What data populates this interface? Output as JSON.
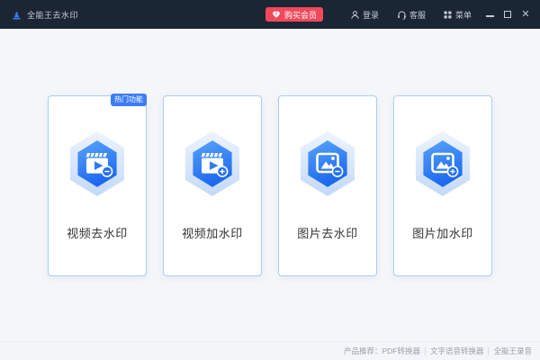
{
  "app": {
    "title": "全能王去水印"
  },
  "titlebar": {
    "buy_button_label": "购买会员",
    "login_label": "登录",
    "support_label": "客服",
    "menu_label": "菜单",
    "icons": {
      "logo": "stamp-icon",
      "buy": "heart-icon",
      "login": "user-icon",
      "support": "headset-icon",
      "menu": "grid-menu-icon",
      "window": [
        "minimize-icon",
        "maximize-icon",
        "close-icon"
      ]
    }
  },
  "cards": [
    {
      "label": "视频去水印",
      "badge": "热门功能",
      "icon": "video-remove-watermark-icon"
    },
    {
      "label": "视频加水印",
      "icon": "video-add-watermark-icon"
    },
    {
      "label": "图片去水印",
      "icon": "image-remove-watermark-icon"
    },
    {
      "label": "图片加水印",
      "icon": "image-add-watermark-icon"
    }
  ],
  "footer": {
    "prefix": "产品推荐：",
    "links": [
      "PDF转换器",
      "文字语音转换器",
      "全能王录音"
    ]
  },
  "colors": {
    "titlebar_bg": "#1b2635",
    "titlebar_text": "#c6cdd6",
    "buy_button_bg": "#f2485c",
    "accent_blue": "#3b7cf7",
    "hex_gradient_top": "#58a4fa",
    "hex_gradient_bottom": "#1d68ef",
    "hex_ring_top": "#edf4fe",
    "hex_ring_bottom": "#c3d9f7",
    "main_bg": "#f5f6f9",
    "card_bg": "#ffffff",
    "card_border": "#abcdf2",
    "card_label_color": "#333333",
    "footer_text": "#9aa1ab"
  }
}
